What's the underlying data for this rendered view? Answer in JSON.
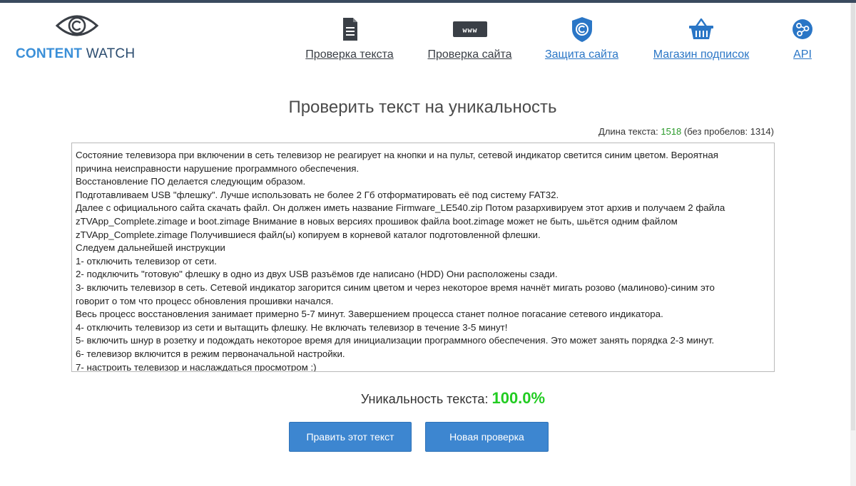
{
  "colors": {
    "accent": "#3a8fd8",
    "button": "#3d86d0",
    "nav_icon_dark": "#3a3f46",
    "nav_icon_blue": "#2a76c6",
    "uniqueness_value": "#22cc22",
    "length_value": "#2a9a2a"
  },
  "logo": {
    "icon": "eye-copyright-icon",
    "text_part1": "CONTENT",
    "text_part2": "WATCH"
  },
  "nav": [
    {
      "label": "Проверка текста",
      "icon": "document-icon"
    },
    {
      "label": "Проверка сайта",
      "icon": "www-icon",
      "icon_text": "www"
    },
    {
      "label": "Защита сайта",
      "icon": "shield-copyright-icon"
    },
    {
      "label": "Магазин подписок",
      "icon": "basket-icon"
    },
    {
      "label": "API",
      "icon": "api-share-icon"
    }
  ],
  "main": {
    "title": "Проверить текст на уникальность",
    "length_label": "Длина текста:",
    "length_value": "1518",
    "length_no_spaces": "(без пробелов: 1314)",
    "text_lines": [
      "Состояние телевизора при включении в сеть телевизор не реагирует на кнопки и на пульт, сетевой индикатор светится синим цветом. Вероятная",
      "причина неисправности нарушение программного обеспечения.",
      "Восстановление ПО делается следующим образом.",
      "Подготавливаем USB \"флешку\". Лучше использовать не более 2 Гб отформатировать её под систему FAT32.",
      "Далее с официального сайта скачать файл. Он должен иметь название Firmware_LE540.zip Потом разархивируем этот архив и получаем 2 файла",
      "zTVApp_Complete.zimage и boot.zimage Внимание в новых версиях прошивок файла boot.zimage может не быть, шьётся одним файлом",
      "zTVApp_Complete.zimage Получившиеся файл(ы) копируем в корневой каталог подготовленной флешки.",
      "Следуем дальнейшей инструкции",
      "1- отключить телевизор от сети.",
      "2- подключить \"готовую\" флешку в одно из двух USB разъёмов где написано (HDD) Они расположены сзади.",
      "3- включить телевизор в сеть. Сетевой индикатор загорится синим цветом и через некоторое время начнёт мигать розово (малиново)-синим это",
      "говорит о том что процесс обновления прошивки начался.",
      "Весь процесс восстановления занимает примерно 5-7 минут. Завершением процесса станет полное погасание сетевого индикатора.",
      "4- отключить телевизор из сети и вытащить флешку. Не включать телевизор в течение 3-5 минут!",
      "5- включить шнур в розетку и подождать некоторое время для инициализации программного обеспечения. Это может занять порядка 2-3 минут.",
      "6- телевизор включится в режим первоначальной настройки.",
      "7- настроить телевизор и наслаждаться просмотром :)"
    ],
    "uniqueness_label": "Уникальность текста:",
    "uniqueness_value": "100.0%",
    "edit_button": "Править этот текст",
    "new_check_button": "Новая проверка"
  }
}
